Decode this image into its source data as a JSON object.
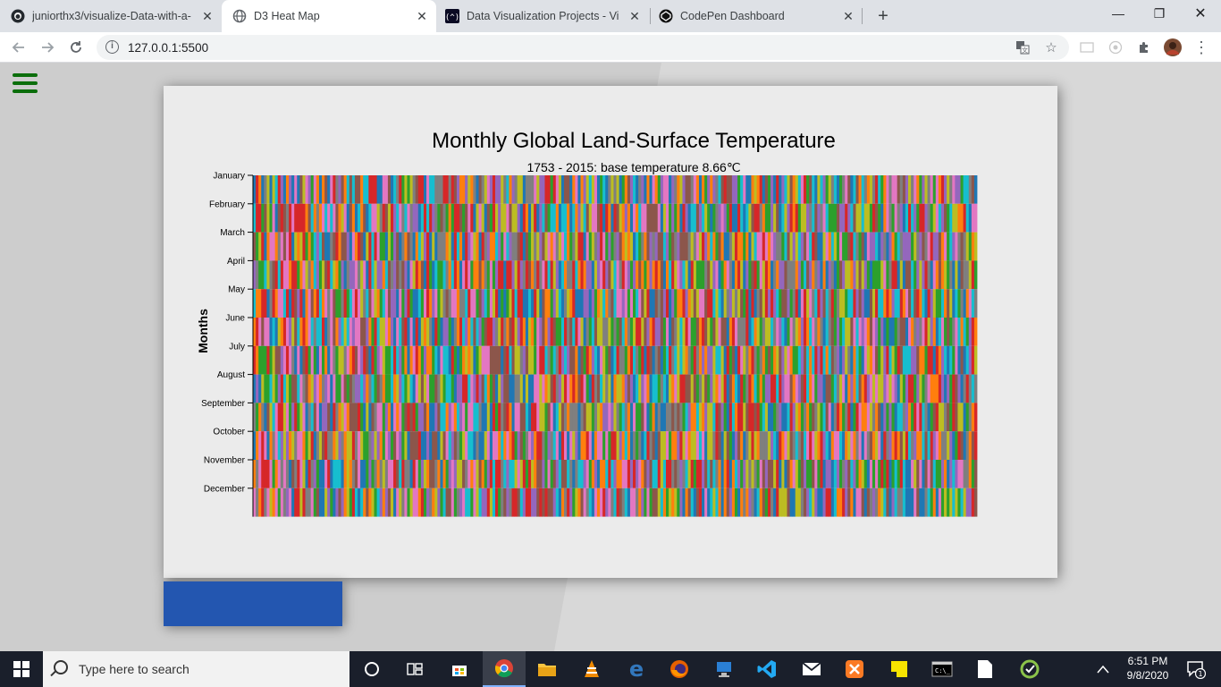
{
  "browser": {
    "tabs": [
      {
        "title": "juniorthx3/visualize-Data-with-a-",
        "icon": "github-icon"
      },
      {
        "title": "D3 Heat Map",
        "icon": "globe-icon"
      },
      {
        "title": "Data Visualization Projects - Visu",
        "icon": "freecodecamp-icon"
      },
      {
        "title": "CodePen Dashboard",
        "icon": "codepen-icon"
      }
    ],
    "new_tab": "+",
    "window_controls": {
      "minimize": "—",
      "restore": "❐",
      "close": "✕"
    },
    "url": "127.0.0.1:5500"
  },
  "page": {
    "chart_title": "Monthly Global Land-Surface Temperature",
    "chart_subtitle": "1753 - 2015: base temperature 8.66℃",
    "y_axis_label": "Months"
  },
  "chart_data": {
    "type": "heatmap",
    "title": "Monthly Global Land-Surface Temperature",
    "subtitle": "1753 - 2015: base temperature 8.66℃",
    "ylabel": "Months",
    "xlabel": "",
    "x_range": [
      1753,
      2015
    ],
    "y_categories": [
      "January",
      "February",
      "March",
      "April",
      "May",
      "June",
      "July",
      "August",
      "September",
      "October",
      "November",
      "December"
    ],
    "base_temperature": 8.66,
    "palette": [
      "#1f77b4",
      "#ff7f0e",
      "#2ca02c",
      "#d62728",
      "#9467bd",
      "#8c564b",
      "#e377c2",
      "#7f7f7f",
      "#bcbd22",
      "#17becf"
    ],
    "grid": false
  },
  "taskbar": {
    "search_placeholder": "Type here to search",
    "time": "6:51 PM",
    "date": "9/8/2020",
    "notification_count": "1"
  }
}
